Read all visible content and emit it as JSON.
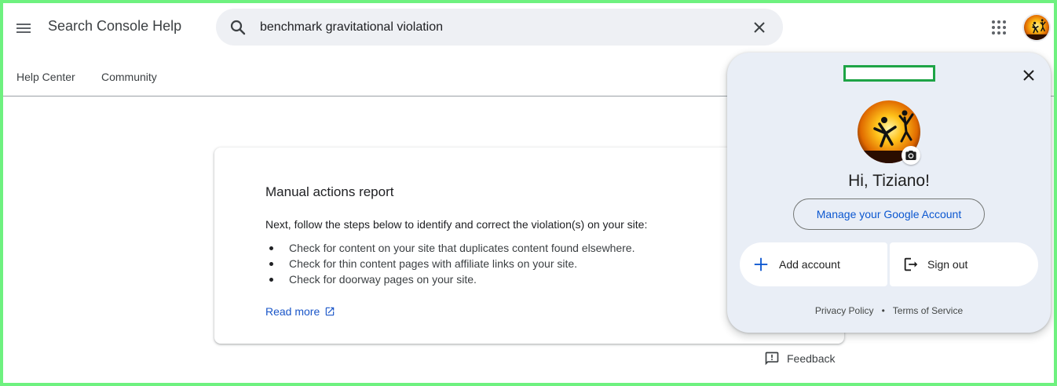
{
  "header": {
    "menu_icon": "hamburger-menu-icon",
    "title": "Search Console Help",
    "search": {
      "value": "benchmark gravitational violation",
      "search_icon": "search-icon",
      "clear_icon": "close-icon"
    },
    "apps_icon": "apps-grid-icon",
    "avatar_icon": "profile-avatar"
  },
  "nav": {
    "items": [
      {
        "label": "Help Center"
      },
      {
        "label": "Community"
      }
    ]
  },
  "card": {
    "title": "Manual actions report",
    "intro": "Next, follow the steps below to identify and correct the violation(s) on your site:",
    "bullets": [
      "Check for content on your site that duplicates content found elsewhere.",
      "Check for thin content pages with affiliate links on your site.",
      "Check for doorway pages on your site."
    ],
    "read_more": "Read more",
    "read_more_icon": "external-link-icon",
    "link_color": "#1a56c8"
  },
  "feedback": {
    "label": "Feedback",
    "icon": "feedback-icon"
  },
  "account_panel": {
    "email_redacted": true,
    "close_icon": "close-icon",
    "camera_icon": "camera-icon",
    "greeting": "Hi, Tiziano!",
    "manage_button": "Manage your Google Account",
    "add_account": "Add account",
    "add_icon": "plus-icon",
    "sign_out": "Sign out",
    "sign_out_icon": "sign-out-icon",
    "privacy_policy": "Privacy Policy",
    "separator": "•",
    "terms": "Terms of Service",
    "background_color": "#e9eef6",
    "accent_color": "#0b57d0"
  },
  "colors": {
    "frame_border": "#6ef17f",
    "search_bg": "#eef0f4",
    "redaction_border": "#1ea446"
  }
}
